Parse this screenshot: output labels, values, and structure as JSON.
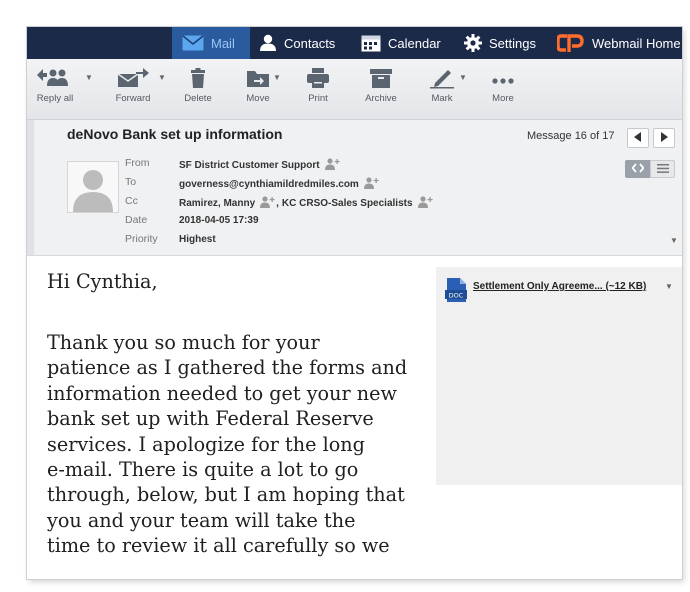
{
  "nav": {
    "mail": "Mail",
    "contacts": "Contacts",
    "calendar": "Calendar",
    "settings": "Settings",
    "webmail_home": "Webmail Home"
  },
  "toolbar": {
    "reply_all": "Reply all",
    "forward": "Forward",
    "delete": "Delete",
    "move": "Move",
    "print": "Print",
    "archive": "Archive",
    "mark": "Mark",
    "more": "More"
  },
  "message": {
    "subject": "deNovo Bank set up information",
    "count": "Message 16 of 17",
    "labels": {
      "from": "From",
      "to": "To",
      "cc": "Cc",
      "date": "Date",
      "priority": "Priority"
    },
    "from": "SF District Customer Support",
    "to": "governess@cynthiamildredmiles.com",
    "cc1": "Ramirez, Manny",
    "cc_sep": ",",
    "cc2": "KC CRSO-Sales Specialists",
    "date": "2018-04-05 17:39",
    "priority": "Highest"
  },
  "body": {
    "greeting": "Hi Cynthia,",
    "lines": [
      "Thank you so much for your",
      "patience as I gathered the forms and",
      "information needed to get your new",
      "bank set up with Federal Reserve",
      "services.  I apologize for the long",
      "e-mail. There is quite a lot to go",
      "through, below, but I am hoping that",
      "you and your team will take the",
      "time to review it all carefully so we"
    ]
  },
  "attachment": {
    "name": "Settlement Only Agreeme... (~12 KB)",
    "icon_label": "DOC"
  },
  "colors": {
    "nav_bg": "#1c2a4a",
    "nav_active": "#2a5b9e",
    "cpanel_orange": "#ff6c2c",
    "doc_blue": "#2b5fb3"
  }
}
